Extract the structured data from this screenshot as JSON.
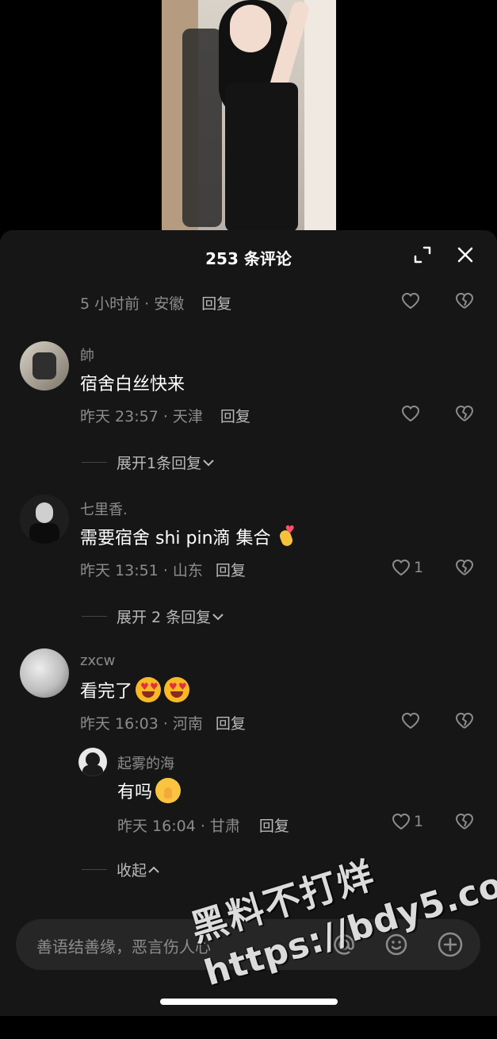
{
  "sheet": {
    "title": "253 条评论"
  },
  "comments": [
    {
      "time": "5 小时前 · 安徽",
      "reply_label": "回复"
    },
    {
      "username": "帥",
      "text": "宿舍白丝快来",
      "time": "昨天 23:57 · 天津",
      "reply_label": "回复",
      "expand_label": "展开1条回复"
    },
    {
      "username": "七里香.",
      "text": "需要宿舍 shi pin滴 集合",
      "time": "昨天 13:51 · 山东",
      "reply_label": "回复",
      "likes": "1",
      "expand_label": "展开 2 条回复"
    },
    {
      "username": "zxcw",
      "text": "看完了",
      "time": "昨天 16:03 · 河南",
      "reply_label": "回复",
      "reply": {
        "username": "起雾的海",
        "text": "有吗",
        "time": "昨天 16:04 · 甘肃",
        "reply_label": "回复",
        "likes": "1"
      },
      "collapse_label": "收起"
    }
  ],
  "input": {
    "placeholder": "善语结善缘，恶言伤人心"
  },
  "watermark": {
    "line1": "黑料不打烊",
    "line2": "https://bdy5.co"
  }
}
